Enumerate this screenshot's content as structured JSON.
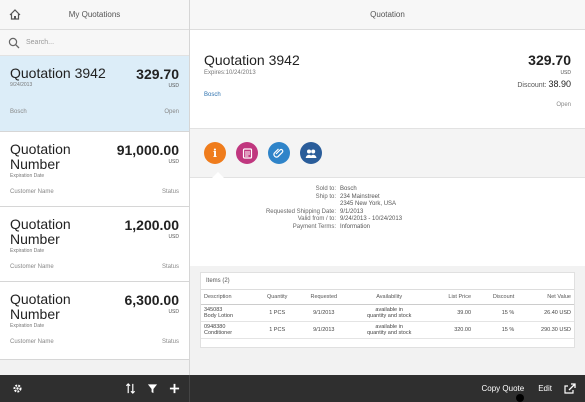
{
  "master": {
    "title": "My Quotations",
    "search_placeholder": "Search...",
    "items": [
      {
        "title": "Quotation 3942",
        "amount": "329.70",
        "currency": "USD",
        "sub": "9/24/2013",
        "left_foot": "Bosch",
        "right_foot": "Open"
      },
      {
        "title": "Quotation Number",
        "amount": "91,000.00",
        "currency": "USD",
        "sub": "Expiration Date",
        "left_foot": "Customer Name",
        "right_foot": "Status"
      },
      {
        "title": "Quotation Number",
        "amount": "1,200.00",
        "currency": "USD",
        "sub": "Expiration Date",
        "left_foot": "Customer Name",
        "right_foot": "Status"
      },
      {
        "title": "Quotation Number",
        "amount": "6,300.00",
        "currency": "USD",
        "sub": "Expiration Date",
        "left_foot": "Customer Name",
        "right_foot": "Status"
      }
    ]
  },
  "detail": {
    "title": "Quotation",
    "object": {
      "title": "Quotation 3942",
      "expires": "Expires:10/24/2013",
      "seller": "Bosch",
      "amount": "329.70",
      "currency": "USD",
      "discount_label": "Discount:",
      "discount_value": "38.90",
      "status": "Open"
    },
    "info": [
      {
        "label": "Sold to:",
        "value": "Bosch"
      },
      {
        "label": "Ship to:",
        "value": "234 Mainstreet"
      },
      {
        "label": "",
        "value": "2345 New York, USA"
      },
      {
        "label": "Requested Shipping Date:",
        "value": "9/1/2013"
      },
      {
        "label": "Valid from / to:",
        "value": "9/24/2013 - 10/24/2013"
      },
      {
        "label": "Payment Terms:",
        "value": "Information"
      }
    ],
    "items": {
      "title": "Items (2)",
      "columns": [
        "Description",
        "Quantity",
        "Requested",
        "Availability",
        "List Price",
        "Discount",
        "Net Value"
      ],
      "rows": [
        {
          "desc1": "345083",
          "desc2": "Body Lotion",
          "qty": "1 PCS",
          "req": "9/1/2013",
          "avail1": "available in",
          "avail2": "quantity and stock",
          "price": "39.00",
          "discount": "15 %",
          "net": "26.40 USD"
        },
        {
          "desc1": "0948380",
          "desc2": "Conditioner",
          "qty": "1 PCS",
          "req": "9/1/2013",
          "avail1": "available in",
          "avail2": "quantity and stock",
          "price": "320.00",
          "discount": "15 %",
          "net": "290.30 USD"
        }
      ]
    }
  },
  "footer": {
    "copy_quote": "Copy Quote",
    "edit": "Edit"
  },
  "colors": {
    "selected_item": "#dcedf8",
    "info_tab": "#ef7c1c",
    "notes_tab": "#c0377f",
    "attachments_tab": "#2f84c9",
    "contacts_tab": "#2a5d9a",
    "link": "#2a6fad",
    "toolbar": "#2f2f2f"
  }
}
